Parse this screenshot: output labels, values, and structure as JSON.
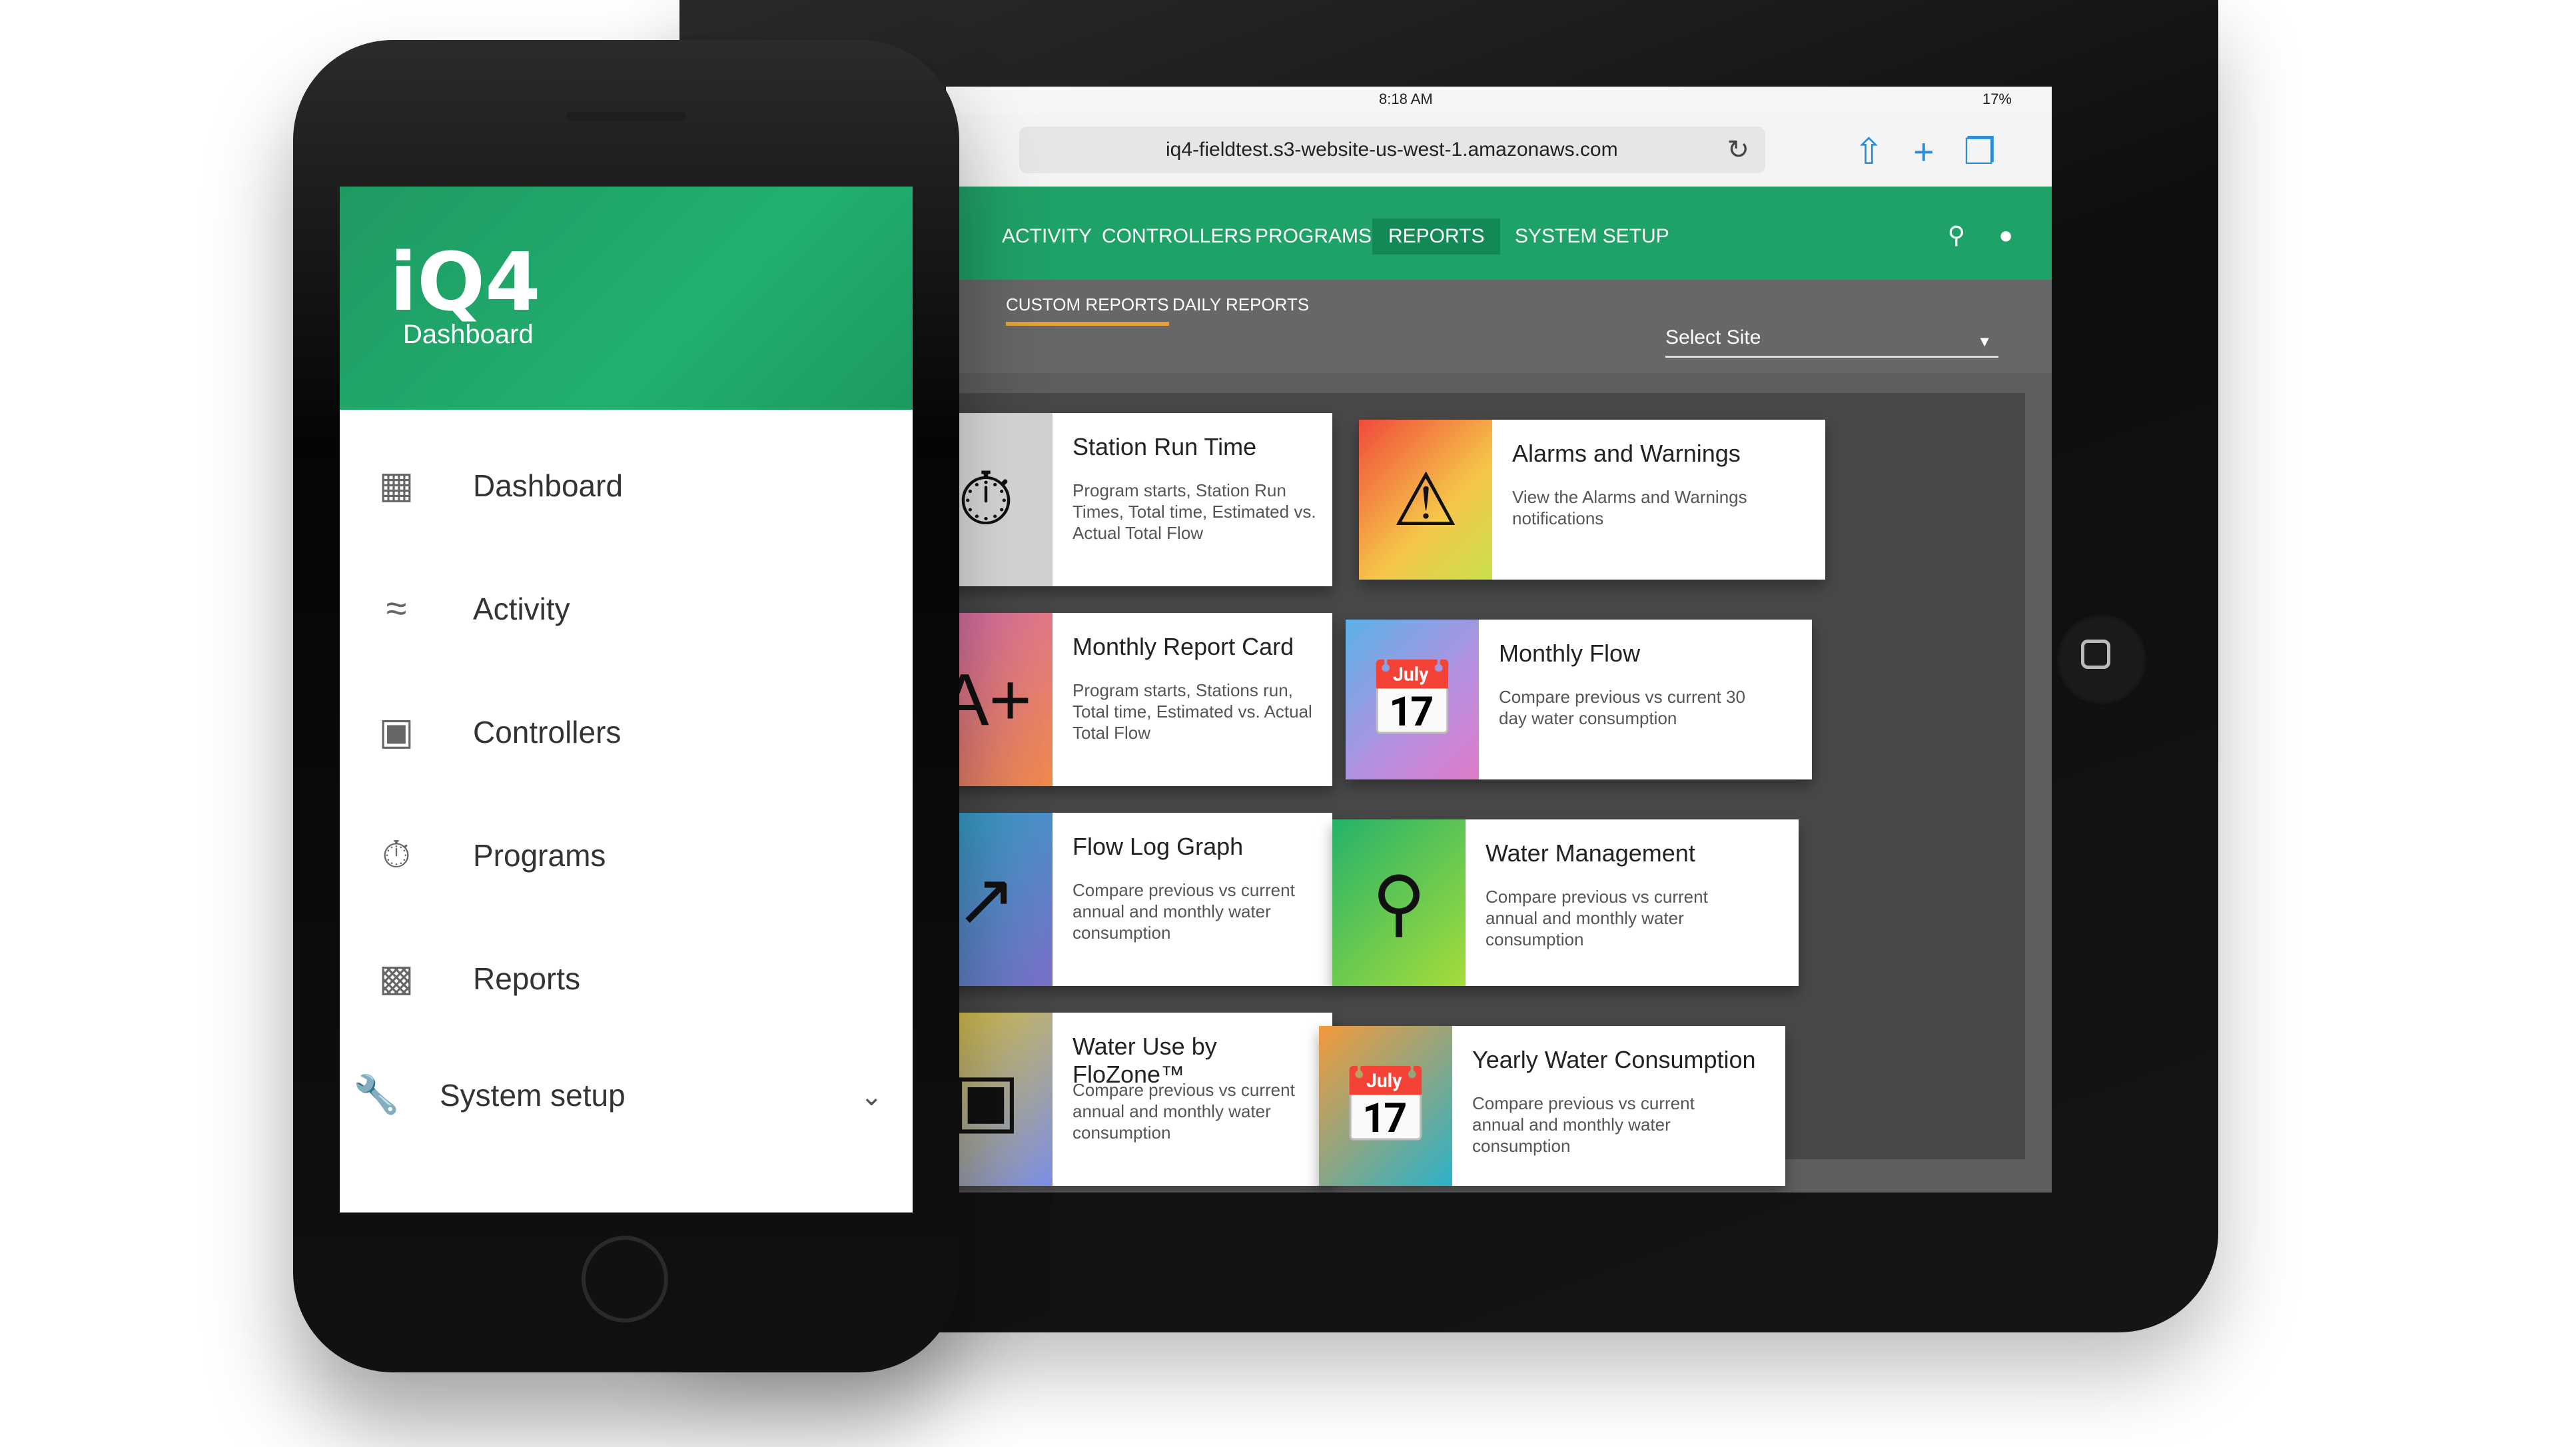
{
  "phone": {
    "logo": "iQ4",
    "logo_sub": "Dashboard",
    "menu": [
      {
        "label": "Dashboard",
        "icon": "dashboard-icon"
      },
      {
        "label": "Activity",
        "icon": "signal-icon"
      },
      {
        "label": "Controllers",
        "icon": "controller-icon"
      },
      {
        "label": "Programs",
        "icon": "stopwatch-icon"
      },
      {
        "label": "Reports",
        "icon": "bar-chart-icon"
      },
      {
        "label": "System setup",
        "icon": "wrench-icon"
      }
    ]
  },
  "tablet": {
    "status": {
      "time": "8:18 AM",
      "battery": "17%"
    },
    "url": "iq4-fieldtest.s3-website-us-west-1.amazonaws.com",
    "nav": [
      "ACTIVITY",
      "CONTROLLERS",
      "PROGRAMS",
      "REPORTS",
      "SYSTEM SETUP"
    ],
    "active_nav": "REPORTS",
    "subtabs": [
      "CUSTOM REPORTS",
      "DAILY REPORTS"
    ],
    "select_site": "Select Site",
    "cards": [
      {
        "title": "Station Run Time",
        "desc": "Program starts, Station Run Times, Total time, Estimated vs. Actual Total Flow",
        "icon": "stopwatch-icon"
      },
      {
        "title": "Alarms and Warnings",
        "desc": "View the Alarms and Warnings notifications",
        "icon": "alarm-badge-icon"
      },
      {
        "title": "Monthly Report Card",
        "desc": "Program starts, Stations run, Total time, Estimated vs. Actual Total Flow",
        "icon": "grade-icon"
      },
      {
        "title": "Monthly Flow",
        "desc": "Compare previous vs current 30 day water consumption",
        "icon": "calendar-icon"
      },
      {
        "title": "Flow Log Graph",
        "desc": "Compare previous vs current annual and monthly water consumption",
        "icon": "trend-arrow-icon"
      },
      {
        "title": "Water Management",
        "desc": "Compare previous vs current annual and monthly water consumption",
        "icon": "sprinkler-icon"
      },
      {
        "title": "Water Use by FloZone™",
        "desc": "Compare previous vs current annual and monthly water consumption",
        "icon": "zone-icon"
      },
      {
        "title": "Yearly Water Consumption",
        "desc": "Compare previous vs current annual and monthly water consumption",
        "icon": "year-calendar-icon"
      }
    ]
  },
  "colors": {
    "brand_green": "#1fa267",
    "active_tab_underline": "#e5a23a"
  }
}
